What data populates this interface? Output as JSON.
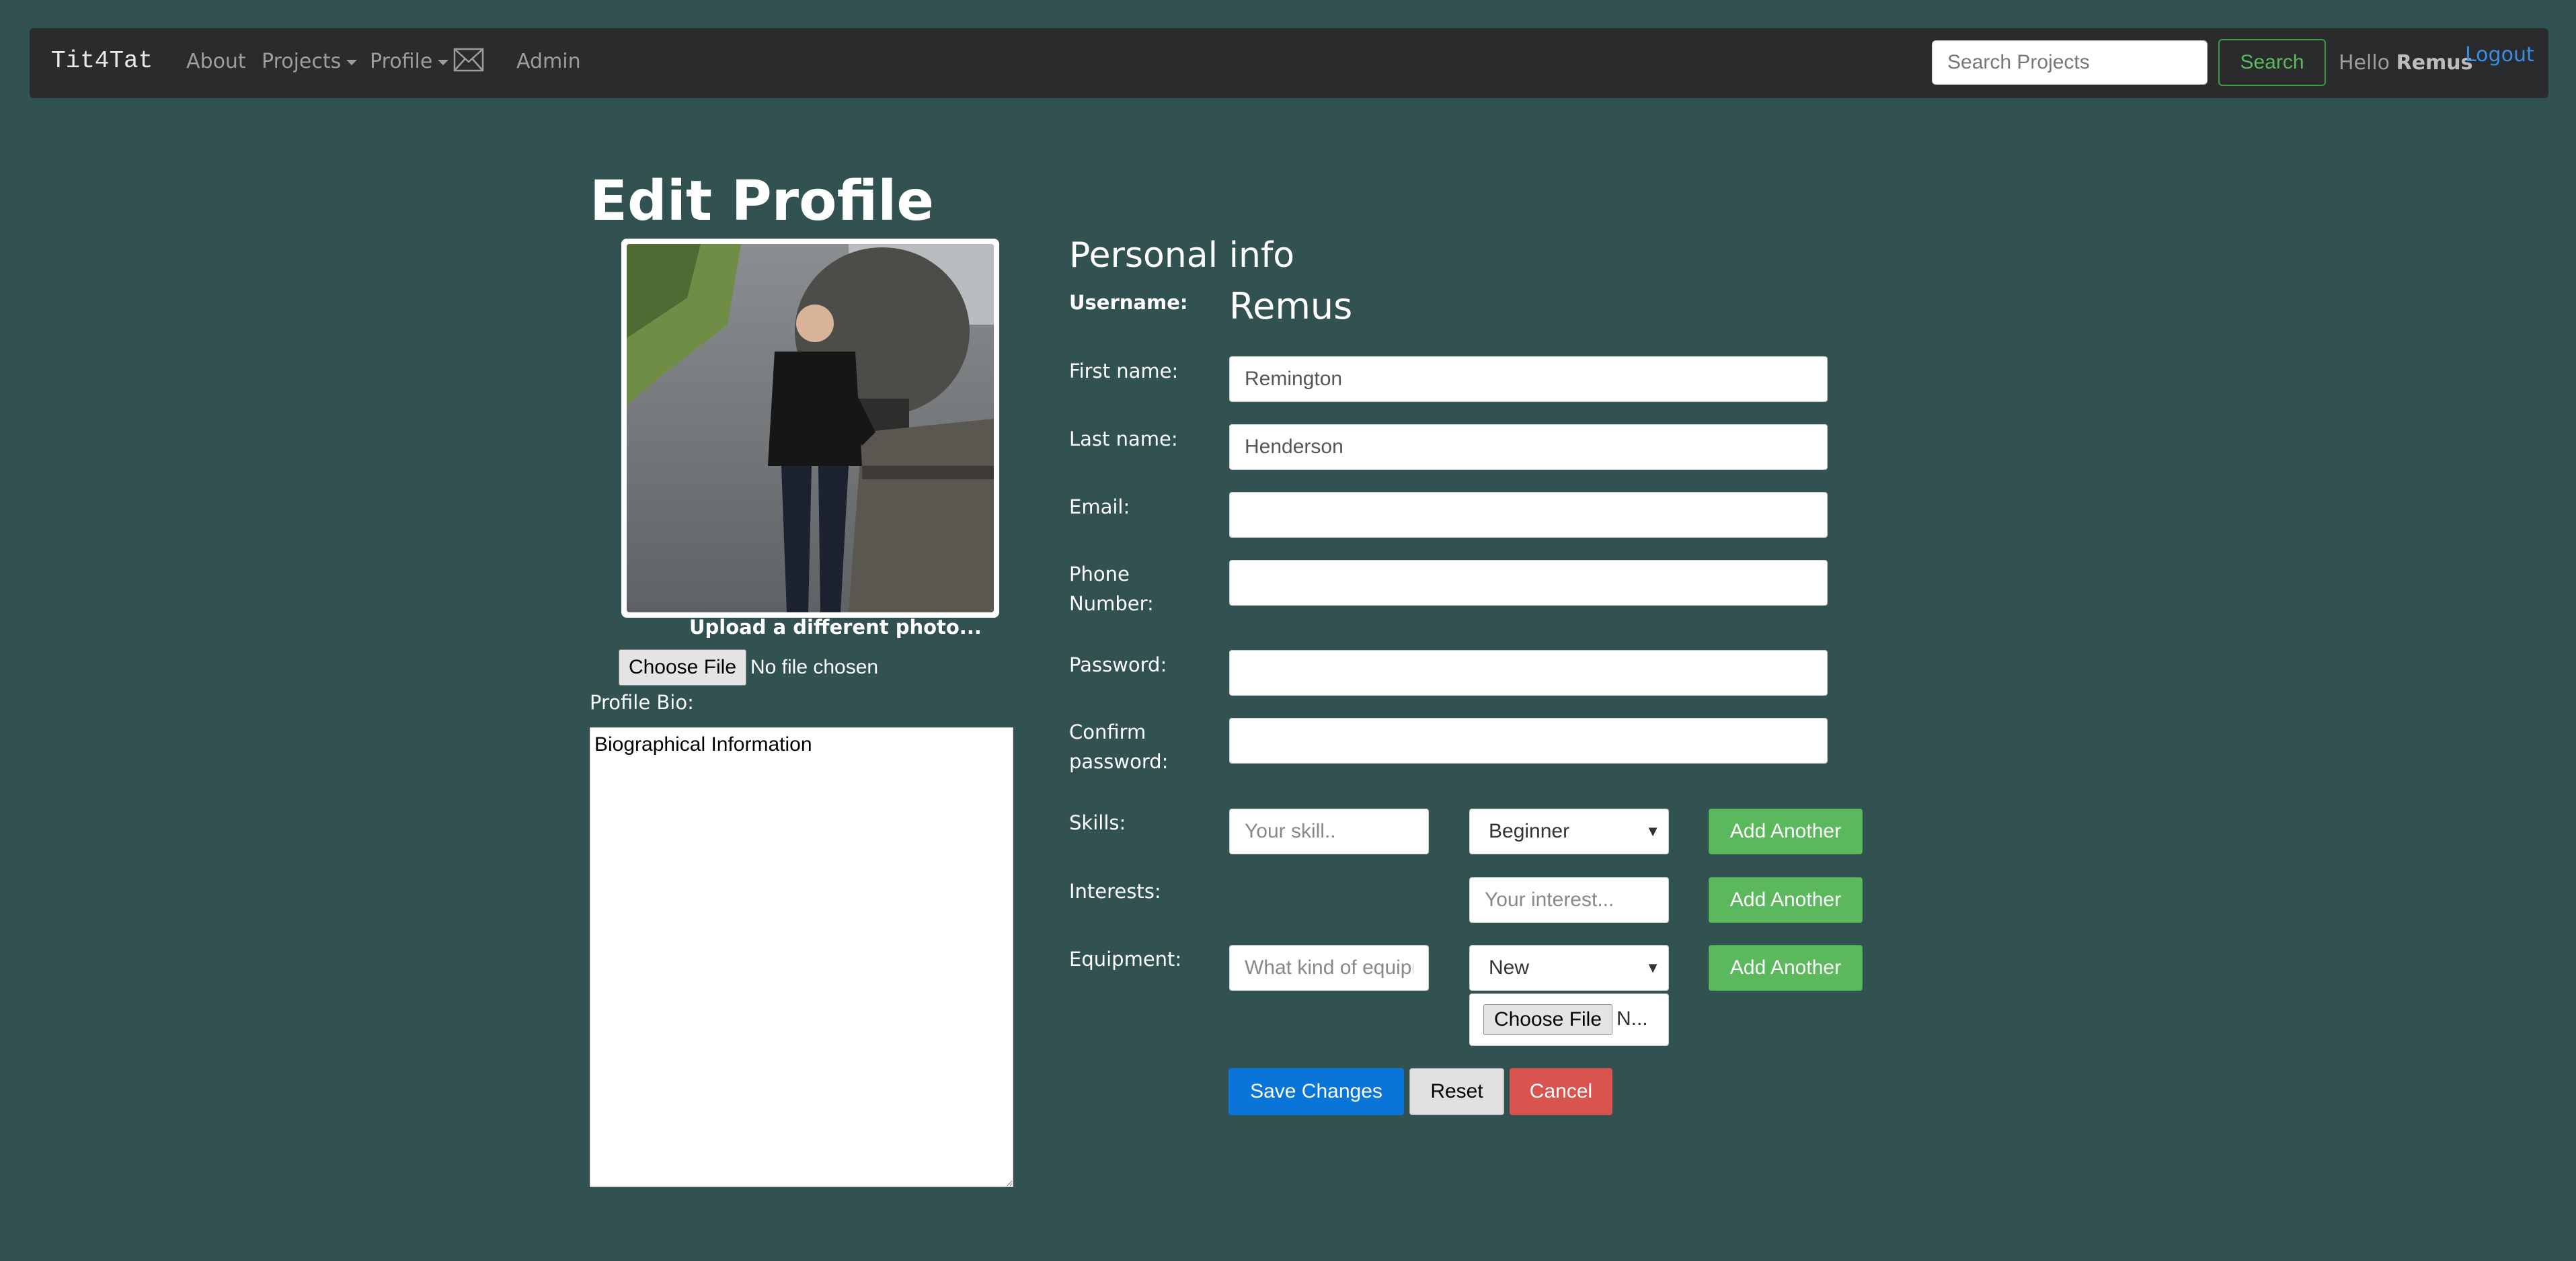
{
  "navbar": {
    "brand": "Tit4Tat",
    "links": [
      "About",
      "Projects",
      "Profile",
      "Admin"
    ],
    "search_placeholder": "Search Projects",
    "search_button": "Search",
    "greeting": "Hello",
    "username": "Remus",
    "logout": "Logout"
  },
  "page": {
    "title": "Edit Profile",
    "section_title": "Personal info"
  },
  "photo": {
    "upload_label": "Upload a different photo...",
    "choose_file": "Choose File",
    "file_status": "No file chosen"
  },
  "bio": {
    "label": "Profile Bio:",
    "value": "Biographical Information"
  },
  "form": {
    "username_label": "Username:",
    "username_value": "Remus",
    "first_name_label": "First name:",
    "first_name_value": "Remington",
    "last_name_label": "Last name:",
    "last_name_value": "Henderson",
    "email_label": "Email:",
    "email_value": "",
    "phone_label": "Phone Number:",
    "phone_value": "",
    "password_label": "Password:",
    "confirm_label": "Confirm password:",
    "skills_label": "Skills:",
    "skill_placeholder": "Your skill..",
    "skill_level": "Beginner",
    "interests_label": "Interests:",
    "interest_placeholder": "Your interest...",
    "equipment_label": "Equipment:",
    "equipment_placeholder": "What kind of equipment?",
    "equipment_condition": "New",
    "equipment_choose_file": "Choose File",
    "equipment_file_status": "N...",
    "add_another": "Add Another"
  },
  "actions": {
    "save": "Save Changes",
    "reset": "Reset",
    "cancel": "Cancel"
  },
  "colors": {
    "background": "#325251",
    "navbar": "#2a2b2c",
    "primary": "#0a75d8",
    "success": "#5cb85c",
    "danger": "#d9534f"
  }
}
